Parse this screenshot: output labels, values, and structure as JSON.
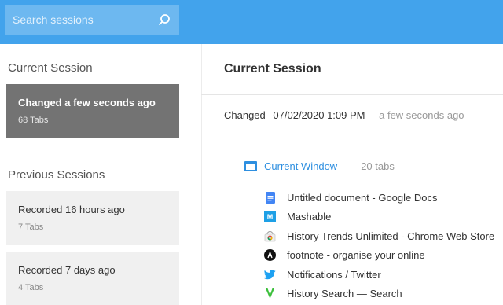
{
  "search": {
    "placeholder": "Search sessions"
  },
  "sidebar": {
    "current_heading": "Current Session",
    "current_card": {
      "title": "Changed a few seconds ago",
      "tabs": "68 Tabs"
    },
    "previous_heading": "Previous Sessions",
    "previous": [
      {
        "title": "Recorded 16 hours ago",
        "tabs": "7 Tabs"
      },
      {
        "title": "Recorded 7 days ago",
        "tabs": "4 Tabs"
      }
    ]
  },
  "main": {
    "title": "Current Session",
    "changed_label": "Changed",
    "changed_datetime": "07/02/2020 1:09 PM",
    "changed_relative": "a few seconds ago",
    "window": {
      "label": "Current Window",
      "count": "20 tabs"
    },
    "tabs": [
      {
        "title": "Untitled document - Google Docs",
        "icon": "google-docs-icon"
      },
      {
        "title": "Mashable",
        "icon": "mashable-icon"
      },
      {
        "title": "History Trends Unlimited - Chrome Web Store",
        "icon": "chrome-web-store-icon"
      },
      {
        "title": "footnote - organise your online",
        "icon": "footnote-icon"
      },
      {
        "title": "Notifications / Twitter",
        "icon": "twitter-icon"
      },
      {
        "title": "History Search — Search",
        "icon": "history-search-icon"
      }
    ]
  },
  "colors": {
    "accent": "#42a3ec",
    "link": "#2e8fe0",
    "active_card": "#737373"
  }
}
